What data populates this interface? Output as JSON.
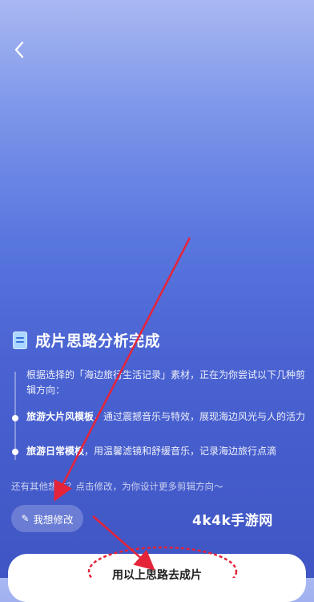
{
  "nav": {
    "back_icon": "chevron-left-icon"
  },
  "header": {
    "icon": "document-icon",
    "title": "成片思路分析完成"
  },
  "content": {
    "description": "根据选择的「海边旅行生活记录」素材，正在为你尝试以下几种剪辑方向：",
    "options": [
      {
        "name": "旅游大片风模板",
        "detail": "，通过震撼音乐与特效，展现海边风光与人的活力"
      },
      {
        "name": "旅游日常模板",
        "detail": "，用温馨滤镜和舒缓音乐，记录海边旅行点滴"
      }
    ],
    "hint": "还有其他想法？点击修改，为你设计更多剪辑方向～"
  },
  "actions": {
    "modify_label": "我想修改",
    "modify_icon": "pencil-icon",
    "primary_label": "用以上思路去成片"
  },
  "watermark": "4k4k手游网",
  "colors": {
    "annotation": "#e5243a",
    "background_top": "#a9b8f2",
    "background_bottom": "#3f55c4"
  }
}
